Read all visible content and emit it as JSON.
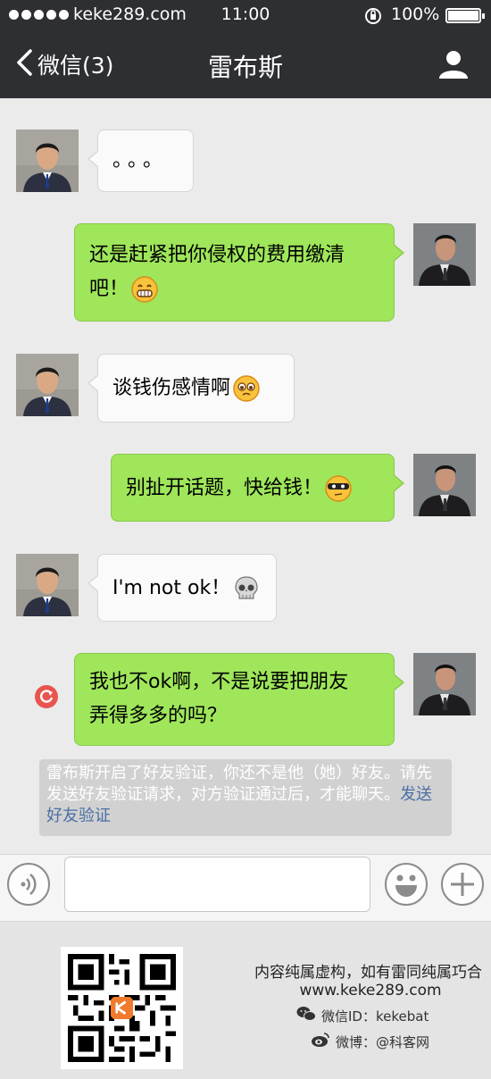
{
  "status_bar": {
    "carrier": "keke289.com",
    "time": "11:00",
    "battery": "100%"
  },
  "nav": {
    "back_label": "微信(3)",
    "title": "雷布斯"
  },
  "messages": [
    {
      "side": "left",
      "text": "。。。",
      "emoji": ""
    },
    {
      "side": "right",
      "text_line1": "还是赶紧把你侵权的费用缴清",
      "text_line2": "吧！",
      "emoji": "grimace-emoji"
    },
    {
      "side": "left",
      "text": "谈钱伤感情啊",
      "emoji": "pleading-emoji"
    },
    {
      "side": "right",
      "text": "别扯开话题，快给钱！",
      "emoji": "masked-emoji"
    },
    {
      "side": "left",
      "text": "I'm not ok！",
      "emoji": "skull-emoji"
    },
    {
      "side": "right",
      "text_line1": "我也不ok啊，不是说要把朋友",
      "text_line2": "弄得多多的吗？",
      "emoji": ""
    }
  ],
  "system_notice": {
    "text": "雷布斯开启了好友验证，你还不是他（她）好友。请先发送好友验证请求，对方验证通过后，才能聊天。",
    "link": "发送好友验证"
  },
  "input": {
    "value": "",
    "placeholder": ""
  },
  "footer": {
    "disclaimer": "内容纯属虚构，如有雷同纯属巧合",
    "url": "www.keke289.com",
    "wechat": "微信ID：kekebat",
    "weibo": "微博：@科客网"
  },
  "colors": {
    "bar_bg": "#2e2f33",
    "chat_bg": "#ebebeb",
    "sent_bubble": "#9fe65a",
    "received_bubble": "#fafafa",
    "link": "#4a6fa5",
    "resend_icon": "#e8554f"
  }
}
